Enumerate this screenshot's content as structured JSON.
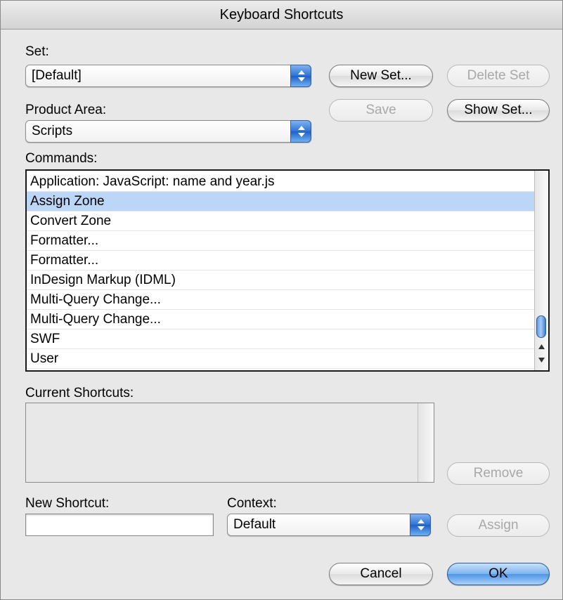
{
  "window": {
    "title": "Keyboard Shortcuts"
  },
  "set": {
    "label": "Set:",
    "selected": "[Default]",
    "new_set_button": "New Set...",
    "delete_set_button": "Delete Set"
  },
  "product_area": {
    "label": "Product Area:",
    "selected": "Scripts",
    "save_button": "Save",
    "show_set_button": "Show Set..."
  },
  "commands": {
    "label": "Commands:",
    "items": [
      "Application: JavaScript: name and year.js",
      "Assign Zone",
      "Convert Zone",
      "Formatter...",
      "Formatter...",
      "InDesign Markup (IDML)",
      "Multi-Query Change...",
      "Multi-Query Change...",
      "SWF",
      "User"
    ],
    "selected_index": 1
  },
  "current_shortcuts": {
    "label": "Current Shortcuts:",
    "remove_button": "Remove"
  },
  "new_shortcut": {
    "label": "New Shortcut:",
    "value": ""
  },
  "context": {
    "label": "Context:",
    "selected": "Default",
    "assign_button": "Assign"
  },
  "footer": {
    "cancel_button": "Cancel",
    "ok_button": "OK"
  },
  "colors": {
    "selection": "#bcd6f7",
    "accent": "#2e72d4",
    "window_bg": "#e8e8e8"
  }
}
